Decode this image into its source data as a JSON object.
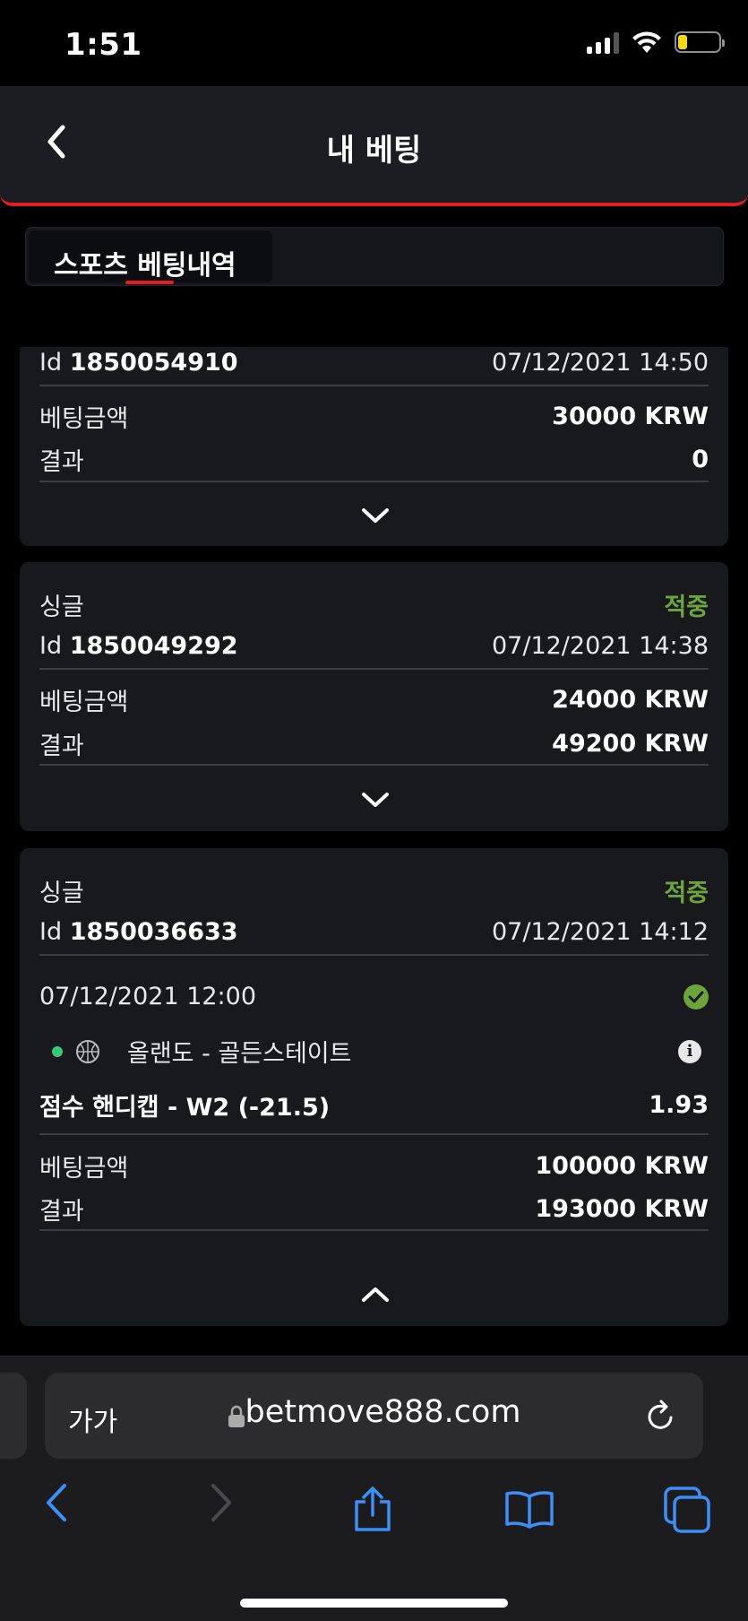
{
  "status_bar": {
    "time": "1:51",
    "battery_level": 0.15
  },
  "header": {
    "title": "내 베팅"
  },
  "tabs": [
    {
      "label": "스포츠 베팅내역",
      "active": true
    }
  ],
  "bets": [
    {
      "id_label": "Id",
      "id": "1850054910",
      "datetime": "07/12/2021 14:50",
      "stake_label": "베팅금액",
      "stake": "30000 KRW",
      "result_label": "결과",
      "result": "0",
      "expanded": false
    },
    {
      "type": "싱글",
      "status": "적중",
      "id_label": "Id",
      "id": "1850049292",
      "datetime": "07/12/2021 14:38",
      "stake_label": "베팅금액",
      "stake": "24000 KRW",
      "result_label": "결과",
      "result": "49200 KRW",
      "expanded": false
    },
    {
      "type": "싱글",
      "status": "적중",
      "id_label": "Id",
      "id": "1850036633",
      "datetime": "07/12/2021 14:12",
      "event": {
        "datetime": "07/12/2021 12:00",
        "match": "올랜도 - 골든스테이트",
        "market": "점수 핸디캡 - W2 (-21.5)",
        "odds": "1.93"
      },
      "stake_label": "베팅금액",
      "stake": "100000 KRW",
      "result_label": "결과",
      "result": "193000 KRW",
      "expanded": true
    }
  ],
  "browser": {
    "text_size": "가가",
    "url": "betmove888.com"
  },
  "colors": {
    "accent": "#e02020",
    "win": "#6ea43c",
    "ios_blue": "#3d8ff5",
    "card": "#17191d"
  }
}
